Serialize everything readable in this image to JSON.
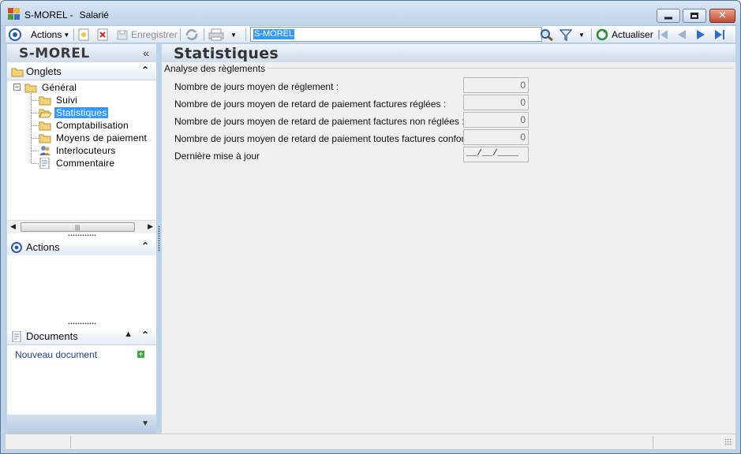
{
  "window": {
    "title_primary": "S-MOREL -",
    "title_secondary": "Salarié"
  },
  "toolbar": {
    "actions_label": "Actions",
    "save_label": "Enregistrer",
    "search_value": "S-MOREL",
    "refresh_label": "Actualiser"
  },
  "left_panel": {
    "record_name": "S-MOREL",
    "collapse_glyph": "«",
    "tabs_section": {
      "title": "Onglets",
      "root": "Général",
      "items": [
        {
          "label": "Suivi",
          "icon": "folder-icon"
        },
        {
          "label": "Statistiques",
          "icon": "folder-open-icon",
          "selected": true
        },
        {
          "label": "Comptabilisation",
          "icon": "folder-icon"
        },
        {
          "label": "Moyens de paiement",
          "icon": "folder-icon"
        },
        {
          "label": "Interlocuteurs",
          "icon": "contacts-icon"
        },
        {
          "label": "Commentaire",
          "icon": "note-icon"
        }
      ]
    },
    "actions_section": {
      "title": "Actions"
    },
    "documents_section": {
      "title": "Documents",
      "new_document": "Nouveau document"
    }
  },
  "main_panel": {
    "title": "Statistiques",
    "group_title": "Analyse des règlements",
    "rows": [
      {
        "label": "Nombre de jours moyen de règlement :",
        "value": "0"
      },
      {
        "label": "Nombre de jours moyen de retard de paiement factures réglées :",
        "value": "0"
      },
      {
        "label": "Nombre de jours moyen de retard de paiement factures non réglées :",
        "value": "0"
      },
      {
        "label": "Nombre de jours moyen de retard de paiement toutes factures confondues :",
        "value": "0"
      },
      {
        "label": "Dernière mise à jour",
        "value": "__/__/____"
      }
    ]
  },
  "colors": {
    "window_frame": "#bcd3ea",
    "selection": "#3399ff",
    "link": "#1a3fa0"
  }
}
